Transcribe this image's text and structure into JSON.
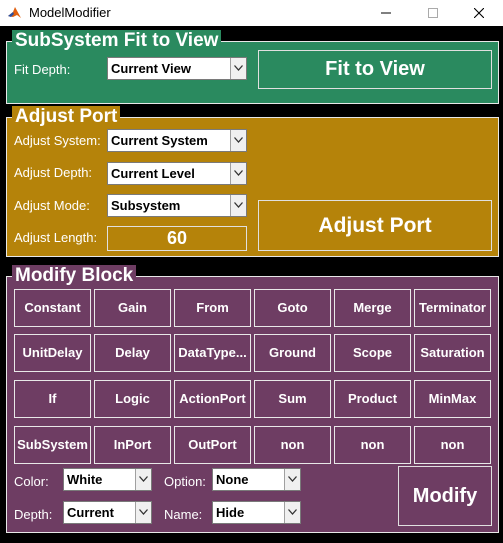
{
  "window": {
    "title": "ModelModifier"
  },
  "colors": {
    "subsystem_panel": "#2a8a5f",
    "adjust_panel": "#b5830a",
    "modify_panel": "#6e3d63"
  },
  "subsystem": {
    "title": "SubSystem Fit to View",
    "fit_depth_label": "Fit Depth:",
    "fit_depth_value": "Current View",
    "fit_button": "Fit to View"
  },
  "adjust": {
    "title": "Adjust Port",
    "system_label": "Adjust System:",
    "system_value": "Current System",
    "depth_label": "Adjust Depth:",
    "depth_value": "Current Level",
    "mode_label": "Adjust Mode:",
    "mode_value": "Subsystem",
    "length_label": "Adjust Length:",
    "length_value": "60",
    "button": "Adjust Port"
  },
  "modify": {
    "title": "Modify Block",
    "blocks": [
      "Constant",
      "Gain",
      "From",
      "Goto",
      "Merge",
      "Terminator",
      "UnitDelay",
      "Delay",
      "DataType...",
      "Ground",
      "Scope",
      "Saturation",
      "If",
      "Logic",
      "ActionPort",
      "Sum",
      "Product",
      "MinMax",
      "SubSystem",
      "InPort",
      "OutPort",
      "non",
      "non",
      "non"
    ],
    "color_label": "Color:",
    "color_value": "White",
    "option_label": "Option:",
    "option_value": "None",
    "depth_label": "Depth:",
    "depth_value": "Current",
    "name_label": "Name:",
    "name_value": "Hide",
    "button": "Modify"
  }
}
